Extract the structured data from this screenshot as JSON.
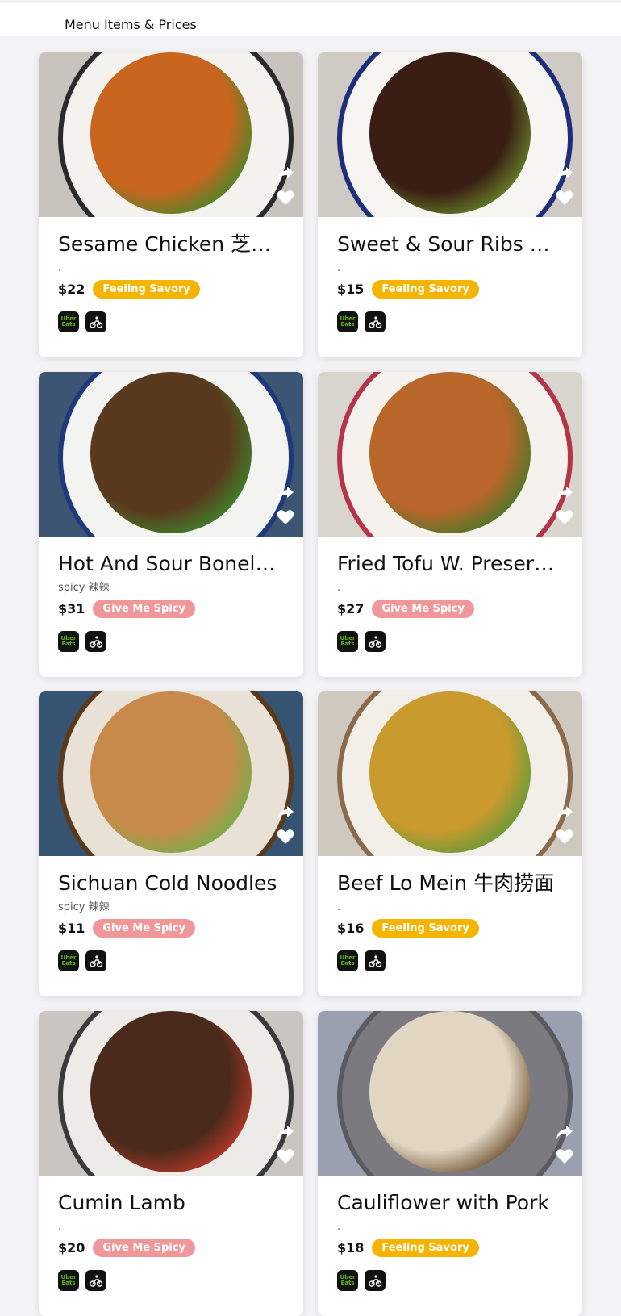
{
  "header": {
    "title": "Menu Items & Prices"
  },
  "items": [
    {
      "name": "Sesame Chicken 芝麻鸡",
      "desc": ".",
      "price": "$22",
      "tag": "Feeling Savory",
      "tag_type": "savory",
      "photo": {
        "bg": "#c8c3bd",
        "plate": "#f4f2ee",
        "rim": "#2a2a2a",
        "food": "#c9651f",
        "accent": "#3f8a2a"
      }
    },
    {
      "name": "Sweet & Sour Ribs 糖醋排骨",
      "desc": ".",
      "price": "$15",
      "tag": "Feeling Savory",
      "tag_type": "savory",
      "photo": {
        "bg": "#cfcac4",
        "plate": "#f7f5f2",
        "rim": "#1d2f7a",
        "food": "#3a1e14",
        "accent": "#6b8c2a"
      }
    },
    {
      "name": "Hot And Sour Boneless Fish",
      "desc": "spicy 辣辣",
      "price": "$31",
      "tag": "Give Me Spicy",
      "tag_type": "spicy",
      "photo": {
        "bg": "#3b5572",
        "plate": "#f3f3f1",
        "rim": "#1f3a7a",
        "food": "#5a3a1e",
        "accent": "#3d8a2c"
      }
    },
    {
      "name": "Fried Tofu W. Preserved Vegetables",
      "desc": ".",
      "price": "$27",
      "tag": "Give Me Spicy",
      "tag_type": "spicy",
      "photo": {
        "bg": "#d8d4ce",
        "plate": "#f5f1ec",
        "rim": "#b4344a",
        "food": "#b8662a",
        "accent": "#3f7a2a"
      }
    },
    {
      "name": "Sichuan Cold Noodles",
      "desc": "spicy 辣辣",
      "price": "$11",
      "tag": "Give Me Spicy",
      "tag_type": "spicy",
      "photo": {
        "bg": "#365472",
        "plate": "#e9e1d6",
        "rim": "#5a3a1c",
        "food": "#c88a4a",
        "accent": "#6fb04a"
      }
    },
    {
      "name": "Beef Lo Mein 牛肉捞面",
      "desc": ".",
      "price": "$16",
      "tag": "Feeling Savory",
      "tag_type": "savory",
      "photo": {
        "bg": "#cfc8bf",
        "plate": "#f2efe9",
        "rim": "#8a6a4a",
        "food": "#c99a2e",
        "accent": "#5a9a3a"
      }
    },
    {
      "name": "Cumin Lamb",
      "desc": ".",
      "price": "$20",
      "tag": "Give Me Spicy",
      "tag_type": "spicy",
      "photo": {
        "bg": "#c9c6c2",
        "plate": "#ecebe8",
        "rim": "#3a3a3a",
        "food": "#4a2a1a",
        "accent": "#c0392b"
      }
    },
    {
      "name": "Cauliflower with Pork",
      "desc": ".",
      "price": "$18",
      "tag": "Feeling Savory",
      "tag_type": "savory",
      "photo": {
        "bg": "#9aa0b0",
        "plate": "#7a7a80",
        "rim": "#5a5a60",
        "food": "#e0d6c2",
        "accent": "#6a4a2a"
      }
    }
  ],
  "delivery": {
    "uber_label_1": "Uber",
    "uber_label_2": "Eats"
  }
}
